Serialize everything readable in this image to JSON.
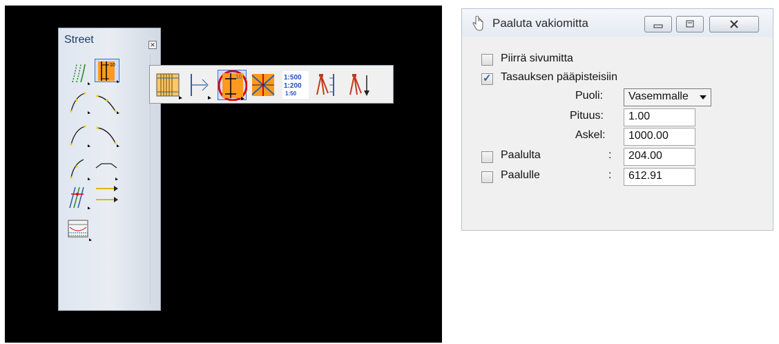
{
  "palette": {
    "title": "Street",
    "tools": [
      {
        "name": "parallel-lines-tool"
      },
      {
        "name": "stationing-tool"
      },
      {
        "name": "curve-tool-1"
      },
      {
        "name": "curve-tool-2"
      },
      {
        "name": "curve-tool-3"
      },
      {
        "name": "curve-tool-4"
      },
      {
        "name": "curve-tool-5"
      },
      {
        "name": "profile-tool"
      },
      {
        "name": "lanes-tool"
      },
      {
        "name": "arrows-tool"
      },
      {
        "name": "cross-section-tool"
      }
    ]
  },
  "flyout": {
    "scale_labels": [
      "1:500",
      "1:200",
      "1:50"
    ],
    "station_label": "10",
    "ruler_label": "10",
    "highlight_color": "#e00000",
    "selected_color": "#ff9a1f"
  },
  "dialog": {
    "title": "Paaluta vakiomitta",
    "draw_side_label": "Piirrä sivumitta",
    "draw_side_checked": false,
    "align_main_label": "Tasauksen pääpisteisiin",
    "align_main_checked": true,
    "side_label": "Puoli:",
    "side_value": "Vasemmalle",
    "length_label": "Pituus:",
    "length_value": "1.00",
    "step_label": "Askel:",
    "step_value": "1000.00",
    "from_label": "Paalulta",
    "from_checked": false,
    "from_colon": ":",
    "from_value": "204.00",
    "to_label": "Paalulle",
    "to_checked": false,
    "to_colon": ":",
    "to_value": "612.91"
  }
}
